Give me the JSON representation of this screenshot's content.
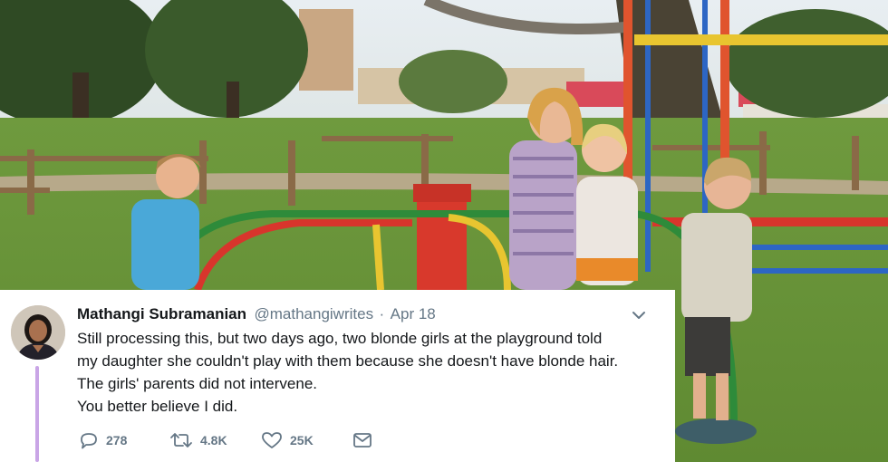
{
  "tweet": {
    "author_name": "Mathangi Subramanian",
    "handle": "@mathangiwrites",
    "separator": "·",
    "date": "Apr 18",
    "text_lines": [
      "Still processing this, but two days ago, two blonde girls at the playground told",
      "my daughter she couldn't play with them because she doesn't have blonde hair.",
      "The girls' parents did not intervene.",
      "You better believe I did."
    ],
    "replies": "278",
    "retweets": "4.8K",
    "likes": "25K"
  },
  "icons": {
    "caret": "chevron-down-icon",
    "reply": "reply-icon",
    "retweet": "retweet-icon",
    "like": "heart-icon",
    "message": "envelope-icon"
  },
  "colors": {
    "text_primary": "#14171a",
    "text_secondary": "#657786",
    "thread_line": "#c9a5e6",
    "card_bg": "#ffffff"
  }
}
